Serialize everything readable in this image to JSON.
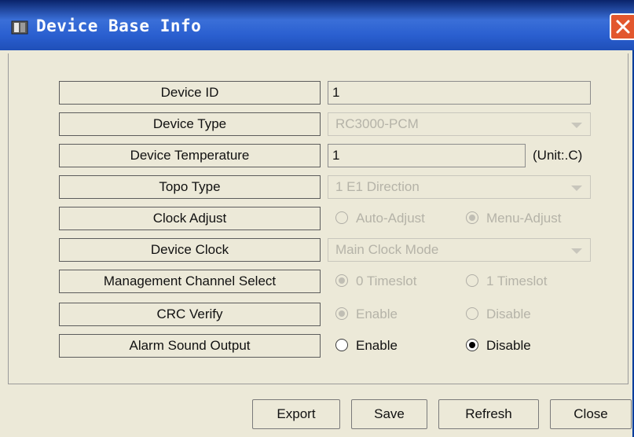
{
  "window": {
    "title": "Device Base Info"
  },
  "rows": [
    {
      "label": "Device ID",
      "value": "1"
    },
    {
      "label": "Device Type",
      "value": "RC3000-PCM"
    },
    {
      "label": "Device Temperature",
      "value": "1",
      "unit": "(Unit:.C)"
    },
    {
      "label": "Topo Type",
      "value": "1 E1 Direction"
    },
    {
      "label": "Clock Adjust",
      "options": [
        "Auto-Adjust",
        "Menu-Adjust"
      ],
      "selected": "Menu-Adjust"
    },
    {
      "label": "Device Clock",
      "value": "Main Clock Mode"
    },
    {
      "label": "Management Channel Select",
      "options": [
        "0 Timeslot",
        "1 Timeslot"
      ],
      "selected": "0 Timeslot"
    },
    {
      "label": "CRC Verify",
      "options": [
        "Enable",
        "Disable"
      ],
      "selected": "Enable"
    },
    {
      "label": "Alarm Sound Output",
      "options": [
        "Enable",
        "Disable"
      ],
      "selected": "Disable"
    }
  ],
  "buttons": {
    "export": "Export",
    "save": "Save",
    "refresh": "Refresh",
    "close": "Close"
  },
  "icons": {
    "window_icon": "document-icon",
    "close_icon": "close-icon",
    "dropdown_icon": "chevron-down-icon"
  },
  "colors": {
    "titlebar": "#2a5fd0",
    "close_button": "#e2572e",
    "background": "#ece9d8"
  }
}
